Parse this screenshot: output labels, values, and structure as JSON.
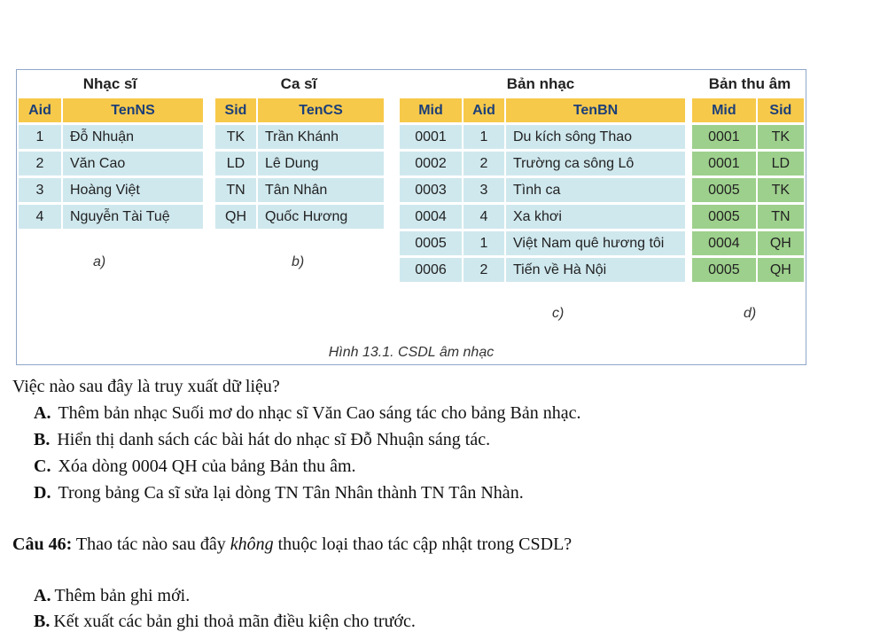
{
  "figure": {
    "titles": {
      "nhac_si": "Nhạc sĩ",
      "ca_si": "Ca sĩ",
      "ban_nhac": "Bản nhạc",
      "ban_thu_am": "Bản thu âm"
    },
    "table_a": {
      "headers": [
        "Aid",
        "TenNS"
      ],
      "rows": [
        [
          "1",
          "Đỗ Nhuận"
        ],
        [
          "2",
          "Văn Cao"
        ],
        [
          "3",
          "Hoàng Việt"
        ],
        [
          "4",
          "Nguyễn Tài Tuệ"
        ]
      ]
    },
    "table_b": {
      "headers": [
        "Sid",
        "TenCS"
      ],
      "rows": [
        [
          "TK",
          "Trần Khánh"
        ],
        [
          "LD",
          "Lê Dung"
        ],
        [
          "TN",
          "Tân Nhân"
        ],
        [
          "QH",
          "Quốc Hương"
        ]
      ]
    },
    "table_c": {
      "headers": [
        "Mid",
        "Aid",
        "TenBN"
      ],
      "rows": [
        [
          "0001",
          "1",
          "Du kích sông Thao"
        ],
        [
          "0002",
          "2",
          "Trường ca sông Lô"
        ],
        [
          "0003",
          "3",
          "Tình ca"
        ],
        [
          "0004",
          "4",
          "Xa khơi"
        ],
        [
          "0005",
          "1",
          "Việt Nam quê hương tôi"
        ],
        [
          "0006",
          "2",
          "Tiến về Hà Nội"
        ]
      ]
    },
    "table_d": {
      "headers": [
        "Mid",
        "Sid"
      ],
      "rows": [
        [
          "0001",
          "TK"
        ],
        [
          "0001",
          "LD"
        ],
        [
          "0005",
          "TK"
        ],
        [
          "0005",
          "TN"
        ],
        [
          "0004",
          "QH"
        ],
        [
          "0005",
          "QH"
        ]
      ]
    },
    "labels": {
      "a": "a)",
      "b": "b)",
      "c": "c)",
      "d": "d)"
    },
    "caption": "Hình 13.1. CSDL âm nhạc"
  },
  "question45": {
    "stem": "Việc nào sau đây là truy xuất dữ liệu?",
    "options": [
      {
        "letter": "A.",
        "text": "Thêm bản nhạc Suối mơ do nhạc sĩ Văn Cao sáng tác cho bảng Bản nhạc."
      },
      {
        "letter": "B.",
        "text": "Hiển thị danh sách các bài hát do nhạc sĩ Đỗ Nhuận sáng tác."
      },
      {
        "letter": "C.",
        "text": "Xóa dòng 0004 QH của bảng Bản thu âm."
      },
      {
        "letter": "D.",
        "text": "Trong bảng Ca sĩ sửa lại dòng TN Tân Nhân thành TN Tân Nhàn."
      }
    ]
  },
  "question46": {
    "label": "Câu 46:",
    "stem_before": "Thao tác nào sau đây",
    "stem_emph": "không",
    "stem_after": "thuộc loại thao tác cập nhật trong CSDL?",
    "options": [
      {
        "letter": "A.",
        "text": "Thêm bản ghi mới."
      },
      {
        "letter": "B.",
        "text": "Kết xuất các bản ghi thoả mãn điều kiện cho trước."
      }
    ]
  }
}
